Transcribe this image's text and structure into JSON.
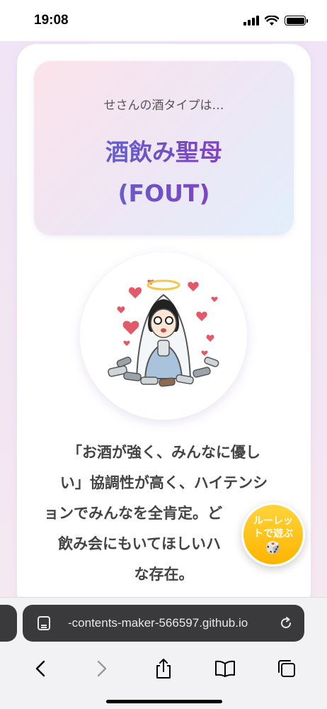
{
  "status_bar": {
    "time": "19:08"
  },
  "result": {
    "prefix": "せさんの酒タイプは…",
    "type_name": "酒飲み聖母",
    "type_code": "(FOUT)"
  },
  "description_lines": [
    "「お酒が強く、みんなに優し",
    "い」協調性が高く、ハイテンシ",
    "ョンでみんなを全肯定。ど",
    "飲み会にもいてほしいハ",
    "な存在。"
  ],
  "roulette": {
    "line1": "ルーレッ",
    "line2": "トで遊ぶ",
    "dice": "🎲"
  },
  "browser": {
    "url": "-contents-maker-566597.github.io"
  },
  "icons": [
    "page-menu-icon",
    "reload-icon",
    "back-icon",
    "forward-icon",
    "share-icon",
    "bookmarks-icon",
    "tabs-icon"
  ],
  "colors": {
    "title_gradient_start": "#4e76d6",
    "title_gradient_end": "#8e3fbf",
    "fab": "#ffbf1a"
  }
}
